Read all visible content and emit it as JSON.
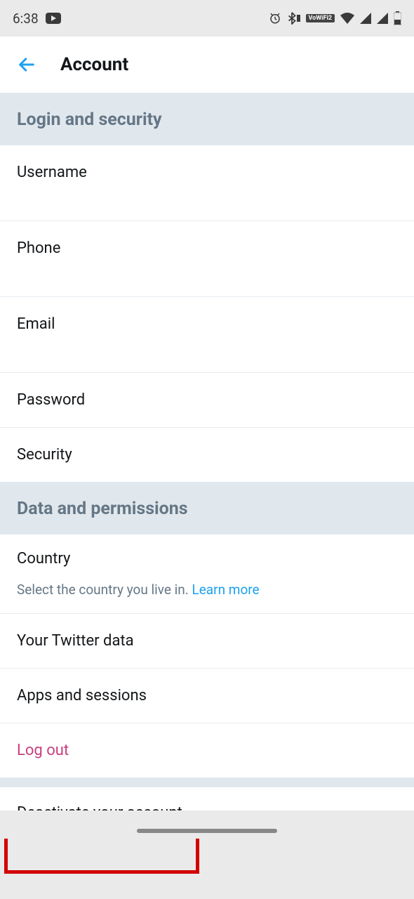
{
  "status": {
    "time": "6:38",
    "vowifi": "VoWiFi2"
  },
  "header": {
    "title": "Account"
  },
  "sections": {
    "login_security": {
      "title": "Login and security",
      "items": {
        "username": "Username",
        "phone": "Phone",
        "email": "Email",
        "password": "Password",
        "security": "Security"
      }
    },
    "data_permissions": {
      "title": "Data and permissions",
      "items": {
        "country": "Country",
        "country_desc": "Select the country you live in. ",
        "learn_more": "Learn more",
        "twitter_data": "Your Twitter data",
        "apps_sessions": "Apps and sessions",
        "log_out": "Log out"
      }
    },
    "deactivate": "Deactivate your account"
  }
}
